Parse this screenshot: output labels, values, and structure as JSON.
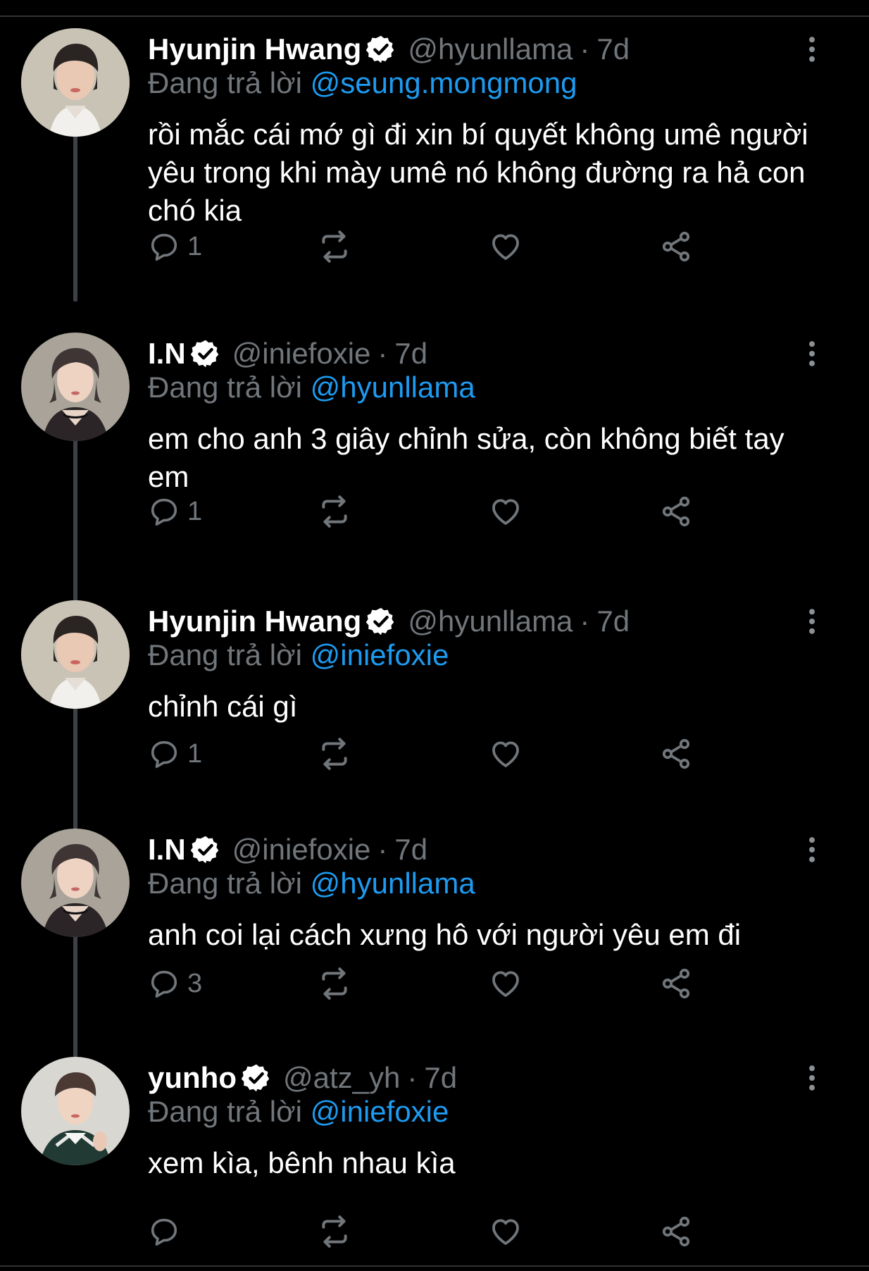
{
  "colors": {
    "background": "#000000",
    "text_primary": "#ffffff",
    "text_secondary": "#71767b",
    "accent": "#1d9bf0",
    "thread_line": "#3d4145"
  },
  "reply_prefix": "Đang trả lời",
  "tweets": [
    {
      "name": "Hyunjin Hwang",
      "handle": "@hyunllama",
      "separator": "·",
      "time": "7d",
      "replying_to": "@seung.mongmong",
      "text": "rồi mắc cái mớ gì đi xin bí quyết không umê người yêu trong khi mày umê nó không đường ra hả con chó kia",
      "reply_count": "1",
      "verified": true
    },
    {
      "name": "I.N",
      "handle": "@iniefoxie",
      "separator": "·",
      "time": "7d",
      "replying_to": "@hyunllama",
      "text": "em cho anh 3 giây chỉnh sửa, còn không biết tay em",
      "reply_count": "1",
      "verified": true
    },
    {
      "name": "Hyunjin Hwang",
      "handle": "@hyunllama",
      "separator": "·",
      "time": "7d",
      "replying_to": "@iniefoxie",
      "text": "chỉnh cái gì",
      "reply_count": "1",
      "verified": true
    },
    {
      "name": "I.N",
      "handle": "@iniefoxie",
      "separator": "·",
      "time": "7d",
      "replying_to": "@hyunllama",
      "text": "anh coi lại cách xưng hô với người yêu em đi",
      "reply_count": "3",
      "verified": true
    },
    {
      "name": "yunho",
      "handle": "@atz_yh",
      "separator": "·",
      "time": "7d",
      "replying_to": "@iniefoxie",
      "text": "xem kìa, bênh nhau kìa",
      "reply_count": "",
      "verified": true
    }
  ],
  "icons": {
    "verified": "verified-badge-icon",
    "more": "more-vertical-icon",
    "reply": "reply-bubble-icon",
    "retweet": "retweet-icon",
    "like": "heart-icon",
    "share": "share-icon"
  }
}
